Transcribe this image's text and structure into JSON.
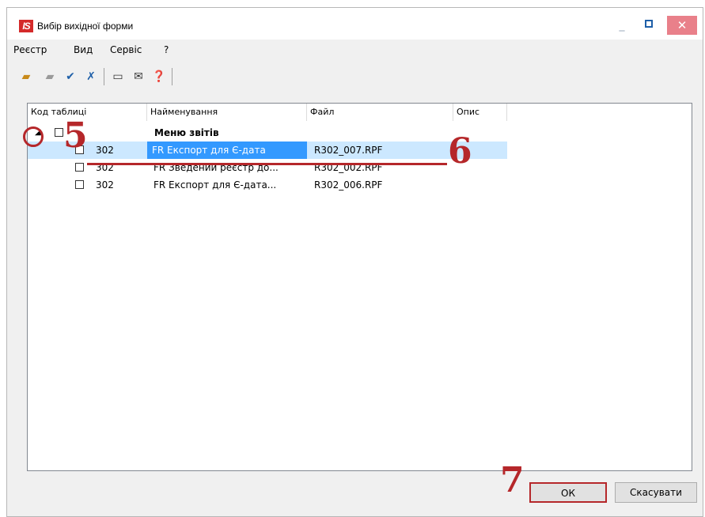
{
  "window": {
    "title": "Вибір вихідної форми",
    "logo_text": "IS"
  },
  "menu": [
    "Реєстр",
    "Вид",
    "Сервіс",
    "?"
  ],
  "toolbar": {
    "icons": [
      "open-folder-icon",
      "folder-icon",
      "check-all-icon",
      "uncheck-all-icon",
      "form-icon",
      "email-icon",
      "help-icon"
    ]
  },
  "table": {
    "columns": [
      "Код таблиці",
      "Найменування",
      "Файл",
      "Опис"
    ],
    "group": {
      "name": "Меню звітів"
    },
    "rows": [
      {
        "code": "302",
        "name": "FR Експорт для Є-дата",
        "file": "R302_007.RPF",
        "selected": true
      },
      {
        "code": "302",
        "name": "FR Зведений реєстр до...",
        "file": "R302_002.RPF",
        "selected": false
      },
      {
        "code": "302",
        "name": "FR Експорт для Є-дата...",
        "file": "R302_006.RPF",
        "selected": false
      }
    ]
  },
  "buttons": {
    "ok": "ОК",
    "cancel": "Скасувати"
  },
  "annotations": {
    "step5": "5",
    "step6": "6",
    "step7": "7",
    "color": "#b5272a"
  }
}
